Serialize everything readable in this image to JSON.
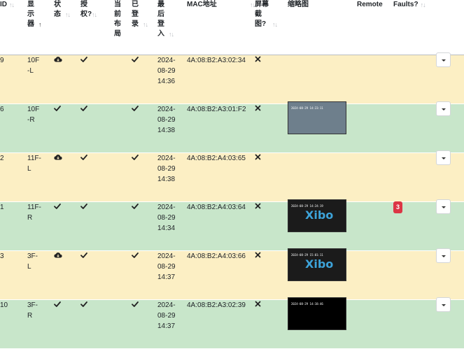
{
  "headers": {
    "id": "ID",
    "display": "显示器",
    "status": "状态",
    "authorised": "授权?",
    "current_layout": "当前布局",
    "logged_in": "已登录",
    "last_accessed": "最后登入",
    "mac": "MAC地址",
    "screenshot": "屏幕截图?",
    "thumbnail": "缩略图",
    "remote": "Remote",
    "faults": "Faults?"
  },
  "rows": [
    {
      "id": "9",
      "display": "10F-L",
      "status": "cloud-download-icon",
      "authorised": "check-icon",
      "logged_in": "check-icon",
      "last_accessed": "2024-08-29 14:36",
      "mac": "4A:08:B2:A3:02:34",
      "screenshot": "close-icon",
      "thumbnail": "",
      "faults": ""
    },
    {
      "id": "6",
      "display": "10F-R",
      "status": "check-icon",
      "authorised": "check-icon",
      "logged_in": "check-icon",
      "last_accessed": "2024-08-29 14:38",
      "mac": "4A:08:B2:A3:01:F2",
      "screenshot": "close-icon",
      "thumbnail": "office",
      "thumbnail_stamp": "2024-08-29 14:23:11",
      "faults": ""
    },
    {
      "id": "2",
      "display": "11F-L",
      "status": "cloud-download-icon",
      "authorised": "check-icon",
      "logged_in": "check-icon",
      "last_accessed": "2024-08-29 14:38",
      "mac": "4A:08:B2:A4:03:65",
      "screenshot": "close-icon",
      "thumbnail": "",
      "faults": ""
    },
    {
      "id": "1",
      "display": "11F-R",
      "status": "check-icon",
      "authorised": "check-icon",
      "logged_in": "check-icon",
      "last_accessed": "2024-08-29 14:34",
      "mac": "4A:08:B2:A4:03:64",
      "screenshot": "close-icon",
      "thumbnail": "xibo",
      "thumbnail_stamp": "2024-08-29 14:24:19",
      "faults": "3"
    },
    {
      "id": "3",
      "display": "3F-L",
      "status": "cloud-download-icon",
      "authorised": "check-icon",
      "logged_in": "check-icon",
      "last_accessed": "2024-08-29 14:37",
      "mac": "4A:08:B2:A4:03:66",
      "screenshot": "close-icon",
      "thumbnail": "xibo",
      "thumbnail_stamp": "2024-08-29 15:01:11",
      "faults": ""
    },
    {
      "id": "10",
      "display": "3F-R",
      "status": "check-icon",
      "authorised": "check-icon",
      "logged_in": "check-icon",
      "last_accessed": "2024-08-29 14:37",
      "mac": "4A:08:B2:A3:02:39",
      "screenshot": "close-icon",
      "thumbnail": "black",
      "thumbnail_stamp": "2024-08-29 14:18:46",
      "faults": ""
    }
  ],
  "colors": {
    "row_yellow": "#fcefc4",
    "row_green": "#c8e6ca",
    "fault_badge": "#dc3545"
  }
}
